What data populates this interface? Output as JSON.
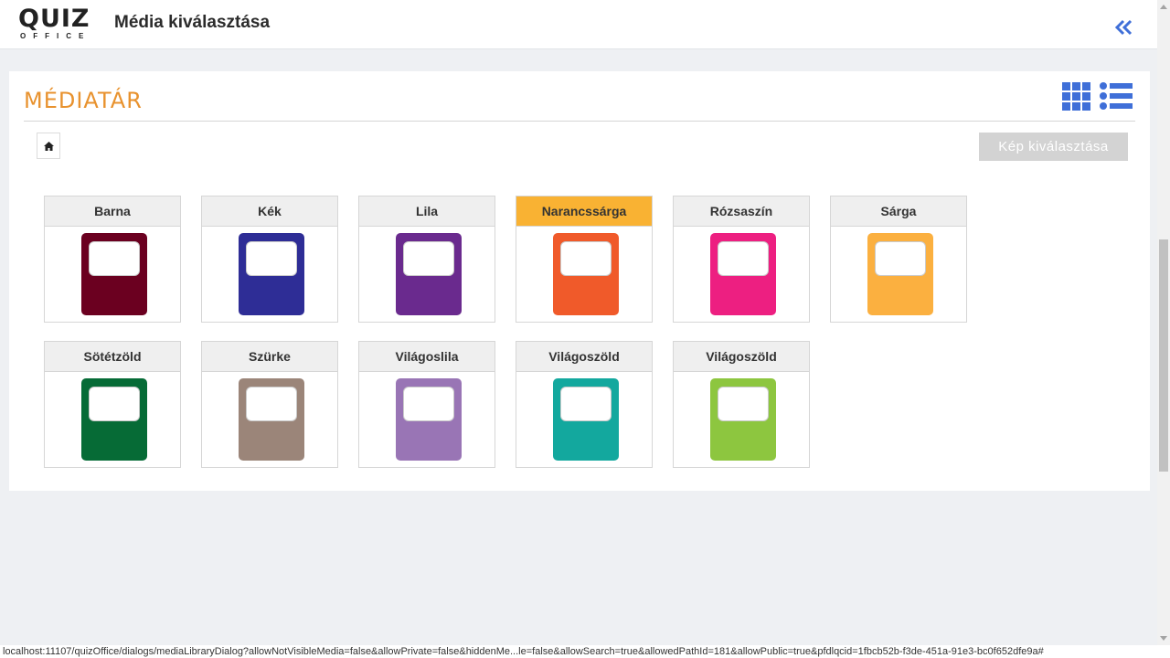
{
  "header": {
    "logo_top": "QUIZ",
    "logo_bottom": "OFFICE",
    "title": "Média kiválasztása",
    "collapse_icon": "double-chevron-left-icon"
  },
  "panel": {
    "title": "MÉDIATÁR",
    "grid_view_icon": "grid-view-icon",
    "list_view_icon": "list-view-icon",
    "home_icon": "home-icon",
    "select_button": "Kép kiválasztása"
  },
  "folders": [
    {
      "label": "Barna",
      "color": "#6b0020"
    },
    {
      "label": "Kék",
      "color": "#2e2d96"
    },
    {
      "label": "Lila",
      "color": "#6a2a8e"
    },
    {
      "label": "Narancssárga",
      "color": "#f05a2a",
      "selected": true
    },
    {
      "label": "Rózsaszín",
      "color": "#ed1f81"
    },
    {
      "label": "Sárga",
      "color": "#fbb040"
    },
    {
      "label": "Sötétzöld",
      "color": "#066b36"
    },
    {
      "label": "Szürke",
      "color": "#9b8579"
    },
    {
      "label": "Világoslila",
      "color": "#9975b5"
    },
    {
      "label": "Világoszöld",
      "color": "#13a89e"
    },
    {
      "label": "Világoszöld",
      "color": "#8dc63f"
    }
  ],
  "accent_color": "#e8922e",
  "selected_header_color": "#f9b233",
  "status_url": "localhost:11107/quizOffice/dialogs/mediaLibraryDialog?allowNotVisibleMedia=false&allowPrivate=false&hiddenMe...le=false&allowSearch=true&allowedPathId=181&allowPublic=true&pfdlqcid=1fbcb52b-f3de-451a-91e3-bc0f652dfe9a#"
}
